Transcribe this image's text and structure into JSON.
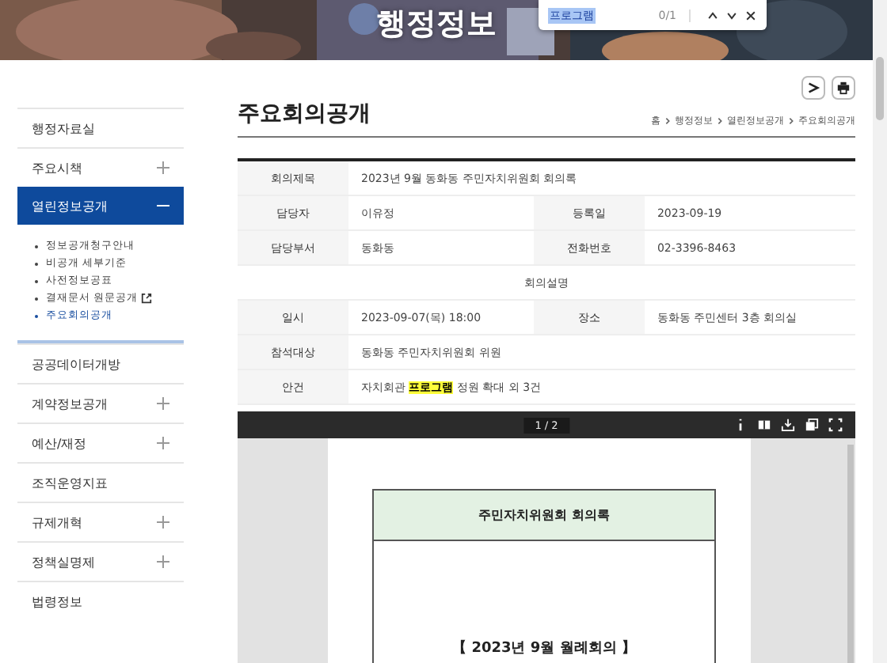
{
  "banner": {
    "title": "행정정보",
    "kind": "picture"
  },
  "find_bar": {
    "value": "프로그램",
    "count": "0/1"
  },
  "sidebar": {
    "items": [
      {
        "label": "행정자료실",
        "expandable": false,
        "selected": false
      },
      {
        "label": "주요시책",
        "expandable": true,
        "expanded": false,
        "selected": false
      },
      {
        "label": "열린정보공개",
        "expandable": true,
        "expanded": true,
        "selected": true,
        "children": [
          {
            "label": "정보공개청구안내",
            "selected": false,
            "external": false
          },
          {
            "label": "비공개 세부기준",
            "selected": false,
            "external": false
          },
          {
            "label": "사전정보공표",
            "selected": false,
            "external": false
          },
          {
            "label": "결재문서 원문공개",
            "selected": false,
            "external": true
          },
          {
            "label": "주요회의공개",
            "selected": true,
            "external": false
          }
        ]
      },
      {
        "label": "공공데이터개방",
        "expandable": false,
        "selected": false
      },
      {
        "label": "계약정보공개",
        "expandable": true,
        "expanded": false,
        "selected": false
      },
      {
        "label": "예산/재정",
        "expandable": true,
        "expanded": false,
        "selected": false
      },
      {
        "label": "조직운영지표",
        "expandable": false,
        "selected": false
      },
      {
        "label": "규제개혁",
        "expandable": true,
        "expanded": false,
        "selected": false
      },
      {
        "label": "정책실명제",
        "expandable": true,
        "expanded": false,
        "selected": false
      },
      {
        "label": "법령정보",
        "expandable": false,
        "selected": false
      }
    ]
  },
  "page": {
    "title": "주요회의공개",
    "breadcrumb": [
      "홈",
      "행정정보",
      "열린정보공개",
      "주요회의공개"
    ]
  },
  "table": {
    "rows": [
      {
        "kind": "fields",
        "cells": [
          {
            "label": "회의제목",
            "value": "2023년 9월 동화동 주민자치위원회 회의록"
          }
        ]
      },
      {
        "kind": "fields",
        "cells": [
          {
            "label": "담당자",
            "value": "이유정"
          },
          {
            "label": "등록일",
            "value": "2023-09-19"
          }
        ]
      },
      {
        "kind": "fields",
        "cells": [
          {
            "label": "담당부서",
            "value": "동화동"
          },
          {
            "label": "전화번호",
            "value": "02-3396-8463"
          }
        ]
      },
      {
        "kind": "section",
        "text": "회의설명"
      },
      {
        "kind": "fields",
        "cells": [
          {
            "label": "일시",
            "value": "2023-09-07(목) 18:00"
          },
          {
            "label": "장소",
            "value": "동화동 주민센터 3층 회의실"
          }
        ]
      },
      {
        "kind": "fields",
        "cells": [
          {
            "label": "참석대상",
            "value": "동화동 주민자치위원회 위원"
          }
        ]
      },
      {
        "kind": "parts",
        "label": "안건",
        "parts": [
          {
            "text": "자치회관 ",
            "highlight": false
          },
          {
            "text": "프로그램",
            "highlight": true
          },
          {
            "text": " 정원 확대 외 3건",
            "highlight": false
          }
        ]
      }
    ]
  },
  "pdf_viewer": {
    "page_counter": "1 / 2",
    "document": {
      "heading": "주민자치위원회 회의록",
      "meeting": "【 2023년 9월 월례회의 】"
    }
  }
}
